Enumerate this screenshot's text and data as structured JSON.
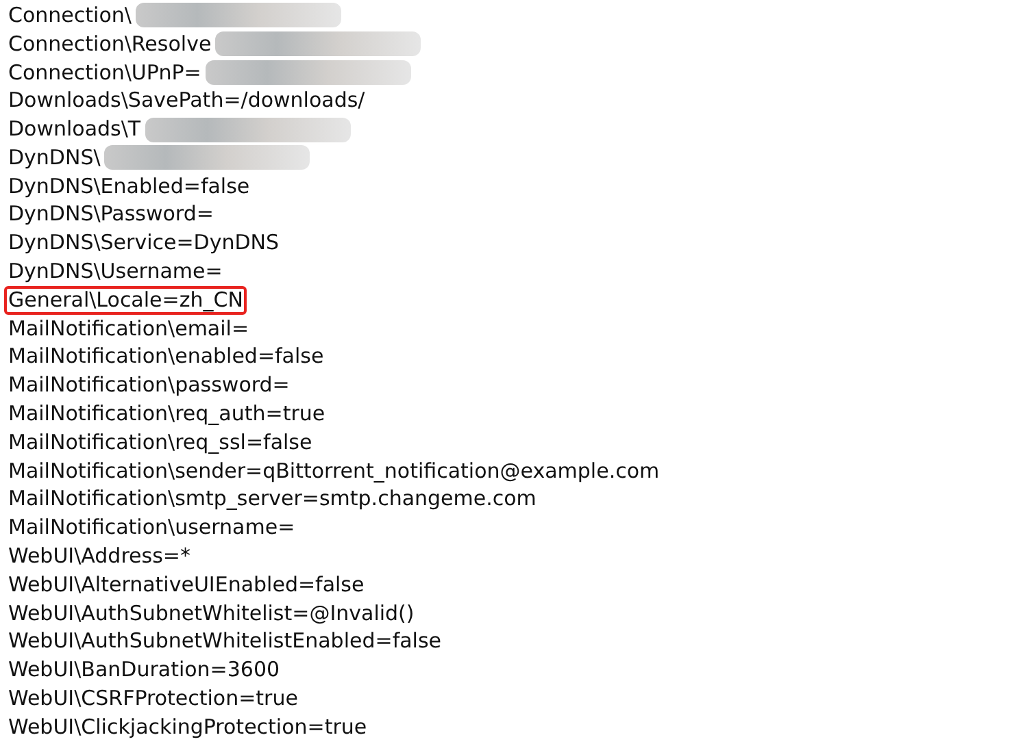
{
  "lines": [
    {
      "text": "Connection\\",
      "blurred": true,
      "highlighted": false
    },
    {
      "text": "Connection\\Resolve",
      "blurred": true,
      "highlighted": false
    },
    {
      "text": "Connection\\UPnP=",
      "blurred": true,
      "highlighted": false
    },
    {
      "text": "Downloads\\SavePath=/downloads/",
      "blurred": false,
      "highlighted": false
    },
    {
      "text": "Downloads\\T",
      "blurred": true,
      "highlighted": false
    },
    {
      "text": "DynDNS\\",
      "blurred": true,
      "highlighted": false
    },
    {
      "text": "DynDNS\\Enabled=false",
      "blurred": false,
      "highlighted": false
    },
    {
      "text": "DynDNS\\Password=",
      "blurred": false,
      "highlighted": false
    },
    {
      "text": "DynDNS\\Service=DynDNS",
      "blurred": false,
      "highlighted": false
    },
    {
      "text": "DynDNS\\Username=",
      "blurred": false,
      "highlighted": false
    },
    {
      "text": "General\\Locale=zh_CN",
      "blurred": false,
      "highlighted": true
    },
    {
      "text": "MailNotification\\email=",
      "blurred": false,
      "highlighted": false
    },
    {
      "text": "MailNotification\\enabled=false",
      "blurred": false,
      "highlighted": false
    },
    {
      "text": "MailNotification\\password=",
      "blurred": false,
      "highlighted": false
    },
    {
      "text": "MailNotification\\req_auth=true",
      "blurred": false,
      "highlighted": false
    },
    {
      "text": "MailNotification\\req_ssl=false",
      "blurred": false,
      "highlighted": false
    },
    {
      "text": "MailNotification\\sender=qBittorrent_notification@example.com",
      "blurred": false,
      "highlighted": false
    },
    {
      "text": "MailNotification\\smtp_server=smtp.changeme.com",
      "blurred": false,
      "highlighted": false
    },
    {
      "text": "MailNotification\\username=",
      "blurred": false,
      "highlighted": false
    },
    {
      "text": "WebUI\\Address=*",
      "blurred": false,
      "highlighted": false
    },
    {
      "text": "WebUI\\AlternativeUIEnabled=false",
      "blurred": false,
      "highlighted": false
    },
    {
      "text": "WebUI\\AuthSubnetWhitelist=@Invalid()",
      "blurred": false,
      "highlighted": false
    },
    {
      "text": "WebUI\\AuthSubnetWhitelistEnabled=false",
      "blurred": false,
      "highlighted": false
    },
    {
      "text": "WebUI\\BanDuration=3600",
      "blurred": false,
      "highlighted": false
    },
    {
      "text": "WebUI\\CSRFProtection=true",
      "blurred": false,
      "highlighted": false
    },
    {
      "text": "WebUI\\ClickjackingProtection=true",
      "blurred": false,
      "highlighted": false
    }
  ]
}
